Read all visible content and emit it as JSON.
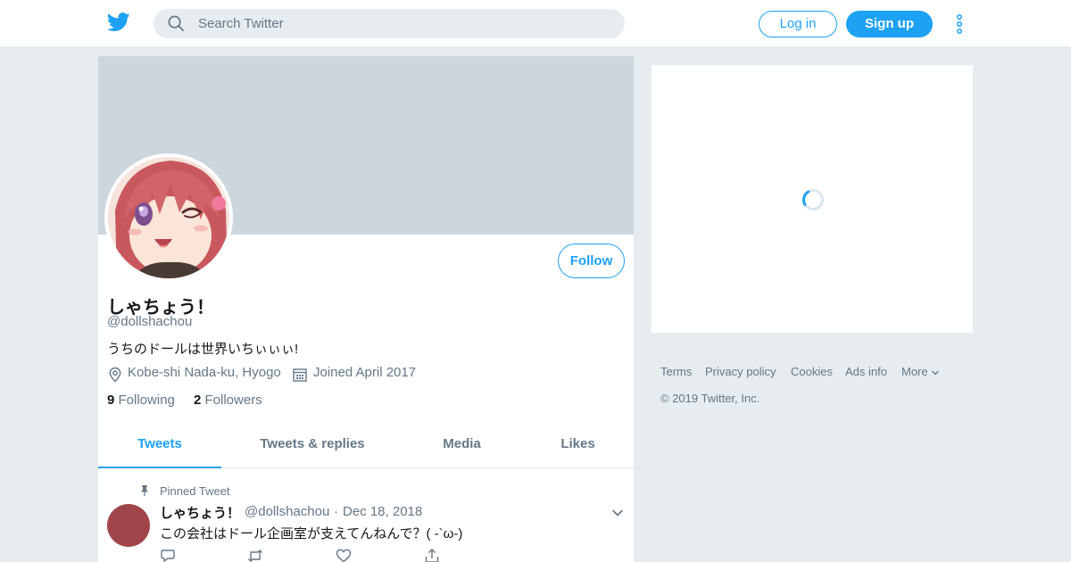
{
  "header": {
    "search_placeholder": "Search Twitter",
    "login_label": "Log in",
    "signup_label": "Sign up"
  },
  "profile": {
    "display_name": "しゃちょう！",
    "handle": "@dollshachou",
    "bio": "うちのドールは世界いちぃぃぃ!",
    "location": "Kobe-shi Nada-ku, Hyogo",
    "joined": "Joined April 2017",
    "following_count": "9",
    "following_label": "Following",
    "followers_count": "2",
    "followers_label": "Followers",
    "follow_label": "Follow"
  },
  "tabs": [
    {
      "label": "Tweets"
    },
    {
      "label": "Tweets & replies"
    },
    {
      "label": "Media"
    },
    {
      "label": "Likes"
    }
  ],
  "pinned_tweet": {
    "pinned_label": "Pinned Tweet",
    "author_name": "しゃちょう！",
    "author_handle": "@dollshachou",
    "separator": "·",
    "date": "Dec 18, 2018",
    "text": "この会社はドール企画室が支えてんねんで？( -`ω-)"
  },
  "footer": {
    "links": [
      {
        "label": "Terms"
      },
      {
        "label": "Privacy policy"
      },
      {
        "label": "Cookies"
      },
      {
        "label": "Ads info"
      },
      {
        "label": "More"
      }
    ],
    "copyright": "© 2019 Twitter, Inc."
  },
  "colors": {
    "accent": "#1da1f2",
    "background": "#e6ecf0",
    "banner": "#ccd6dd",
    "secondary_text": "#657786",
    "tweet_avatar": "#a0454a"
  },
  "icons": [
    "twitter-logo-icon",
    "search-icon",
    "more-vertical-icon",
    "location-pin-icon",
    "calendar-icon",
    "pin-icon",
    "chevron-down-icon",
    "reply-icon",
    "retweet-icon",
    "like-icon",
    "share-icon",
    "loading-spinner-icon"
  ]
}
